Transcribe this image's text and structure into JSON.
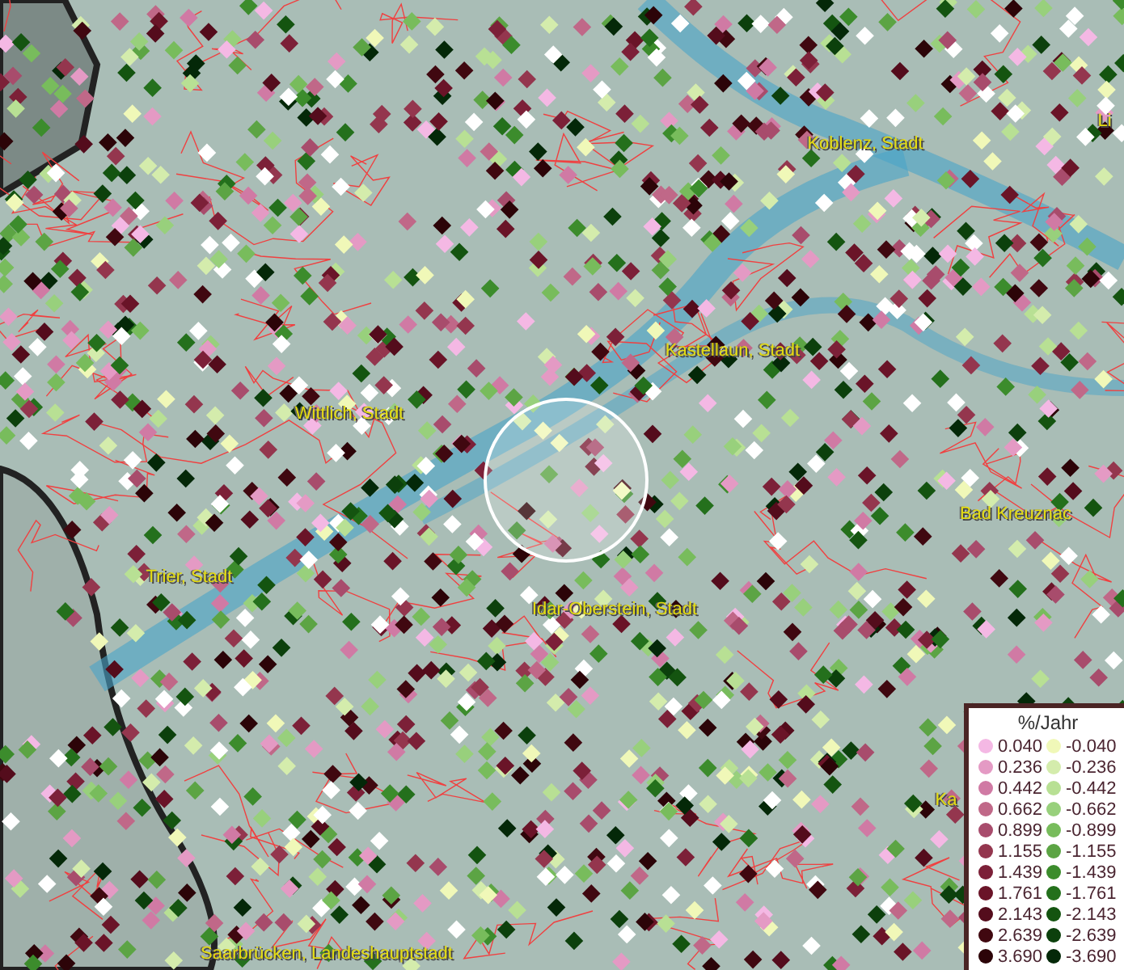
{
  "map_labels": [
    {
      "text": "Li"
    },
    {
      "text": "Koblenz, Stadt"
    },
    {
      "text": "Kastellaun, Stadt"
    },
    {
      "text": "Wittlich, Stadt"
    },
    {
      "text": "Bad Kreuznac"
    },
    {
      "text": "Trier, Stadt"
    },
    {
      "text": "Idar-Oberstein, Stadt"
    },
    {
      "text": "Ka"
    },
    {
      "text": "Saarbrücken, Landeshauptstadt"
    }
  ],
  "legend": {
    "title": "%/Jahr",
    "items": [
      {
        "label": "0.040",
        "color": "#f4b8e4"
      },
      {
        "label": "-0.040",
        "color": "#f0f8b8"
      },
      {
        "label": "0.236",
        "color": "#e49ac4"
      },
      {
        "label": "-0.236",
        "color": "#d4ecac"
      },
      {
        "label": "0.442",
        "color": "#d07aa4"
      },
      {
        "label": "-0.442",
        "color": "#b8e094"
      },
      {
        "label": "0.662",
        "color": "#c06888"
      },
      {
        "label": "-0.662",
        "color": "#98d07c"
      },
      {
        "label": "0.899",
        "color": "#a84c6c"
      },
      {
        "label": "-0.899",
        "color": "#78bc5c"
      },
      {
        "label": "1.155",
        "color": "#94364e"
      },
      {
        "label": "-1.155",
        "color": "#5ca444"
      },
      {
        "label": "1.439",
        "color": "#7c2038"
      },
      {
        "label": "-1.439",
        "color": "#3c8c2c"
      },
      {
        "label": "1.761",
        "color": "#6a1428"
      },
      {
        "label": "-1.761",
        "color": "#24701c"
      },
      {
        "label": "2.143",
        "color": "#540c1c"
      },
      {
        "label": "-2.143",
        "color": "#145410"
      },
      {
        "label": "2.639",
        "color": "#400810"
      },
      {
        "label": "-2.639",
        "color": "#0c400c"
      },
      {
        "label": "3.690",
        "color": "#2c0408"
      },
      {
        "label": "-3.690",
        "color": "#042808"
      }
    ]
  }
}
